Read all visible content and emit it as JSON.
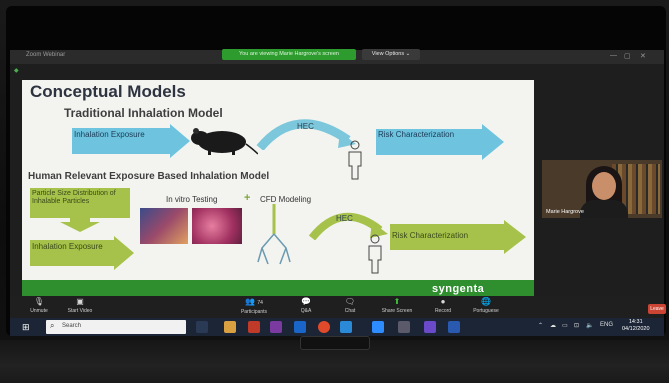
{
  "window": {
    "title": "Zoom Webinar",
    "banner": "You are viewing Marie Hargrove's screen",
    "view_options": "View Options ⌄"
  },
  "slide": {
    "title": "Conceptual Models",
    "subtitle_traditional": "Traditional Inhalation Model",
    "subtitle_human": "Human Relevant Exposure Based Inhalation Model",
    "inhalation_exposure_1": "Inhalation Exposure",
    "hec_1": "HEC",
    "risk_1": "Risk Characterization",
    "particle_size": "Particle Size Distribution of Inhalable Particles",
    "in_vitro": "In vitro Testing",
    "plus": "+",
    "cfd": "CFD Modeling",
    "inhalation_exposure_2": "Inhalation Exposure",
    "hec_2": "HEC",
    "risk_2": "Risk Characterization",
    "brand": "syngenta"
  },
  "video": {
    "participant_name": "Marie Hargrove"
  },
  "toolbar": {
    "unmute": "Unmute",
    "start_video": "Start Video",
    "participants": "Participants",
    "participants_count": "74",
    "qa": "Q&A",
    "chat": "Chat",
    "share_screen": "Share Screen",
    "record": "Record",
    "language": "Portuguese",
    "leave": "Leave"
  },
  "taskbar": {
    "search_placeholder": "Search",
    "language": "ENG",
    "time": "14:31",
    "date": "04/12/2020"
  },
  "colors": {
    "slide_bg": "#f3f4f0",
    "arrow_blue": "#6ec4de",
    "arrow_green": "#a6c24a",
    "brand_green": "#2f8f2f",
    "zoom_green": "#2e9b2e"
  }
}
